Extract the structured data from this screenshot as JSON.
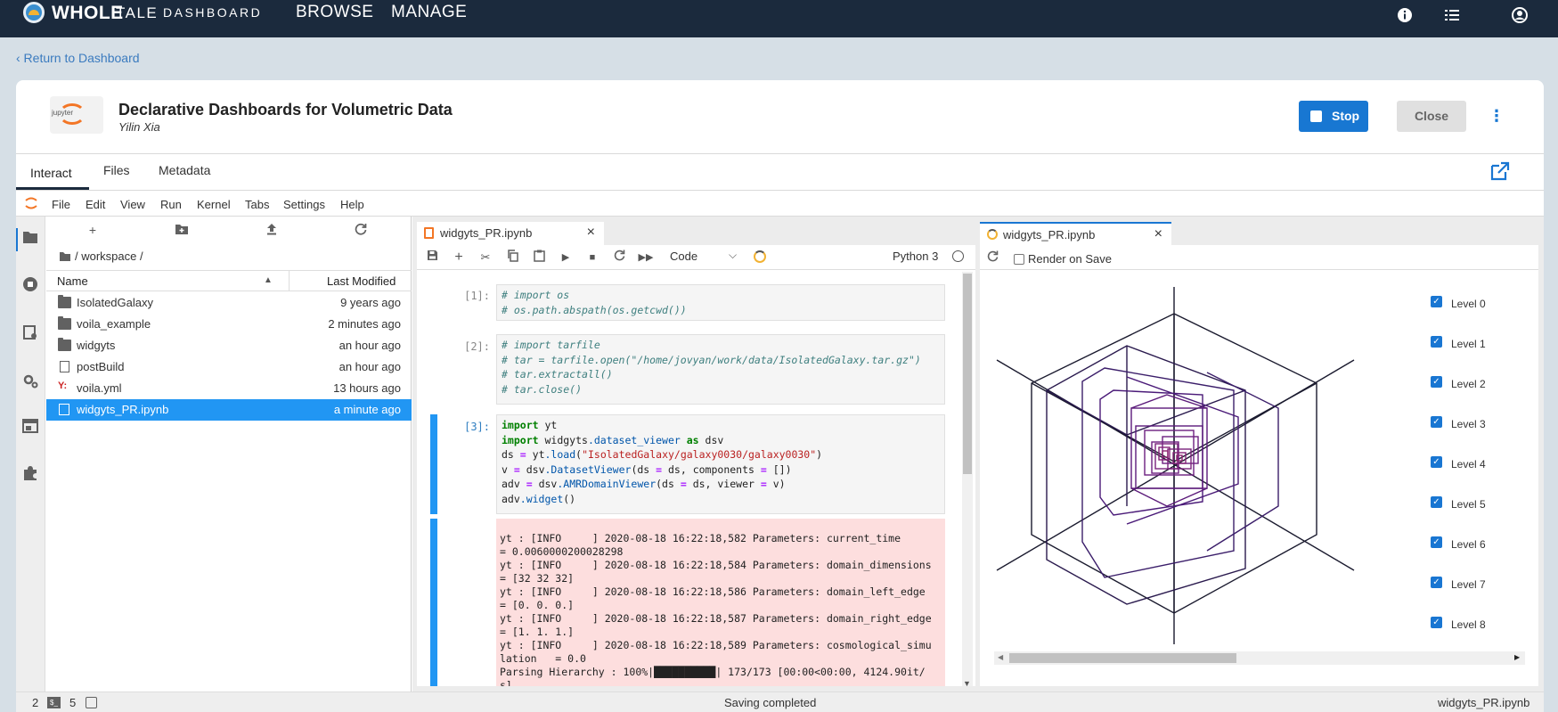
{
  "app": {
    "brand": {
      "whole": "WHOLE",
      "tale": "TALE",
      "dashboard": "DASHBOARD"
    },
    "nav": {
      "browse": "BROWSE",
      "manage": "MANAGE"
    },
    "icons": [
      "info-icon",
      "task-list-icon",
      "user-icon"
    ]
  },
  "return_link": "‹ Return to Dashboard",
  "tale": {
    "title": "Declarative Dashboards for Volumetric Data",
    "author": "Yilin Xia",
    "logo_text": "jupyter",
    "stop_label": "Stop",
    "close_label": "Close",
    "more_glyph": "⋮"
  },
  "tabs": [
    {
      "label": "Interact",
      "active": true
    },
    {
      "label": "Files"
    },
    {
      "label": "Metadata"
    }
  ],
  "menu": [
    "File",
    "Edit",
    "View",
    "Run",
    "Kernel",
    "Tabs",
    "Settings",
    "Help"
  ],
  "file_browser": {
    "path": "/ workspace /",
    "columns": {
      "name": "Name",
      "modified": "Last Modified"
    },
    "files": [
      {
        "name": "IsolatedGalaxy",
        "modified": "9 years ago",
        "type": "folder"
      },
      {
        "name": "voila_example",
        "modified": "2 minutes ago",
        "type": "folder"
      },
      {
        "name": "widgyts",
        "modified": "an hour ago",
        "type": "folder"
      },
      {
        "name": "postBuild",
        "modified": "an hour ago",
        "type": "file"
      },
      {
        "name": "voila.yml",
        "modified": "13 hours ago",
        "type": "yaml"
      },
      {
        "name": "widgyts_PR.ipynb",
        "modified": "a minute ago",
        "type": "notebook",
        "selected": true
      }
    ]
  },
  "notebook": {
    "tab_title": "widgyts_PR.ipynb",
    "cell_type": "Code",
    "kernel": "Python 3",
    "prompts": [
      "[1]:",
      "[2]:",
      "[3]:"
    ],
    "output": [
      "yt : [INFO     ] 2020-08-18 16:22:18,582 Parameters: current_time",
      "= 0.0060000200028298",
      "yt : [INFO     ] 2020-08-18 16:22:18,584 Parameters: domain_dimensions",
      "= [32 32 32]",
      "yt : [INFO     ] 2020-08-18 16:22:18,586 Parameters: domain_left_edge",
      "= [0. 0. 0.]",
      "yt : [INFO     ] 2020-08-18 16:22:18,587 Parameters: domain_right_edge",
      "= [1. 1. 1.]",
      "yt : [INFO     ] 2020-08-18 16:22:18,589 Parameters: cosmological_simu",
      "lation   = 0.0",
      "Parsing Hierarchy : 100%|██████████| 173/173 [00:00<00:00, 4124.90it/",
      "s]"
    ]
  },
  "preview": {
    "tab_title": "widgyts_PR.ipynb",
    "render_on_save": "Render on Save",
    "levels": [
      "Level 0",
      "Level 1",
      "Level 2",
      "Level 3",
      "Level 4",
      "Level 5",
      "Level 6",
      "Level 7",
      "Level 8"
    ]
  },
  "status": {
    "terminals": "2",
    "kernels": "5",
    "message": "Saving completed",
    "file": "widgyts_PR.ipynb"
  },
  "colors": {
    "nav": "#1b2a3d",
    "accent": "#1976d2",
    "output_bg": "#fddede",
    "amr": "#5b1a7a"
  }
}
